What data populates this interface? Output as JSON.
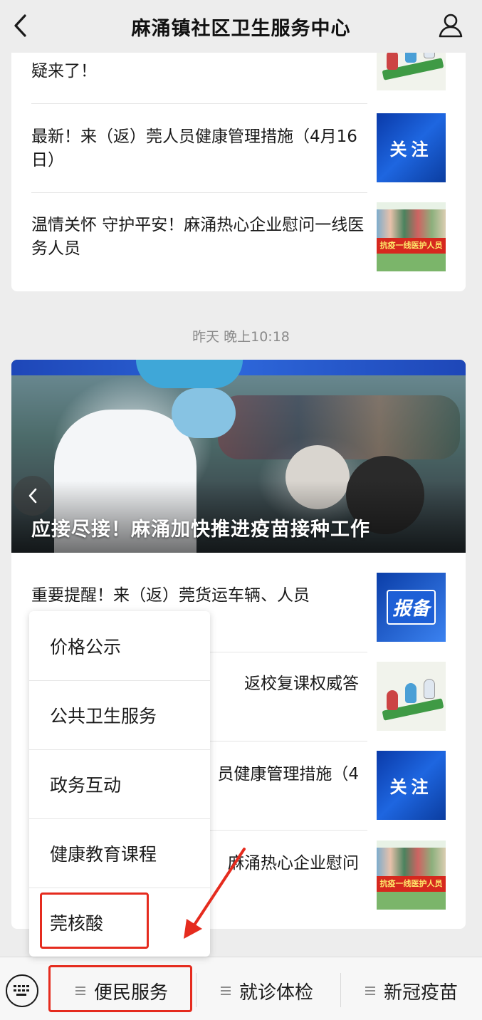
{
  "header": {
    "title": "麻涌镇社区卫生服务中心",
    "back_icon": "chevron-left-icon",
    "profile_icon": "user-icon"
  },
  "card1": {
    "items": [
      {
        "title": "疑来了！",
        "thumb": "cartoon-health-workers"
      },
      {
        "title": "最新！来（返）莞人员健康管理措施（4月16日）",
        "thumb": "guanzhu",
        "thumb_text": "关注"
      },
      {
        "title": "温情关怀 守护平安！麻涌热心企业慰问一线医务人员",
        "thumb": "kangyi-banner",
        "thumb_text": "抗疫一线医护人员"
      }
    ]
  },
  "timestamp": "昨天 晚上10:18",
  "card2": {
    "hero_title": "应接尽接！麻涌加快推进疫苗接种工作",
    "items": [
      {
        "title": "重要提醒！来（返）莞货运车辆、人员",
        "thumb": "baobei",
        "thumb_text": "报备"
      },
      {
        "title": "返校复课权威答",
        "thumb": "cartoon-health-workers"
      },
      {
        "title": "员健康管理措施（4",
        "thumb": "guanzhu",
        "thumb_text": "关注"
      },
      {
        "title": "麻涌热心企业慰问",
        "thumb": "kangyi-banner",
        "thumb_text": "抗疫一线医护人员"
      }
    ]
  },
  "popup_menu": {
    "items": [
      "价格公示",
      "公共卫生服务",
      "政务互动",
      "健康教育课程",
      "莞核酸"
    ]
  },
  "bottom_menu": {
    "keyboard_icon": "keyboard-icon",
    "tabs": [
      "便民服务",
      "就诊体检",
      "新冠疫苗"
    ]
  },
  "colors": {
    "highlight": "#e52b1e",
    "background": "#ededed"
  }
}
